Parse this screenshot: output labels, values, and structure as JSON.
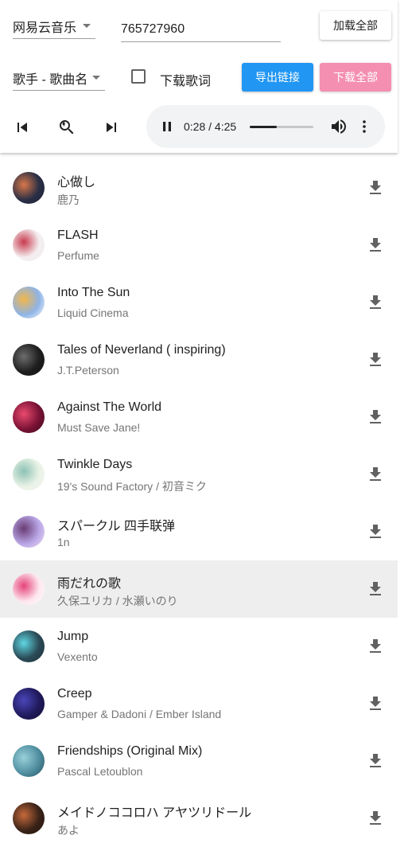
{
  "header": {
    "source_select": {
      "value": "网易云音乐"
    },
    "playlist_input": {
      "value": "765727960"
    },
    "load_all_label": "加载全部",
    "format_select": {
      "value": "歌手 - 歌曲名"
    },
    "lyrics_checkbox": {
      "label": "下载歌词",
      "checked": false
    },
    "export_links_label": "导出链接",
    "download_all_label": "下载全部"
  },
  "controls": {
    "icons": [
      "skip-previous-icon",
      "search-replay-icon",
      "skip-next-icon"
    ]
  },
  "player": {
    "time": "0:28 / 4:25",
    "progress": 0.42,
    "icons": [
      "pause-icon",
      "volume-icon",
      "more-vertical-icon"
    ]
  },
  "colors": {
    "blue": "#2196f3",
    "pink": "#f48fb1",
    "highlight": "#eeeeee"
  },
  "songs": [
    {
      "title": "心做し",
      "artist": "鹿乃",
      "highlight": false,
      "cover": [
        "#2a2f45",
        "#d9774a",
        "#1b2135"
      ]
    },
    {
      "title": "FLASH",
      "artist": "Perfume",
      "highlight": false,
      "cover": [
        "#f4eef0",
        "#c83a4d",
        "#eee"
      ]
    },
    {
      "title": "Into The Sun",
      "artist": "Liquid Cinema",
      "highlight": false,
      "cover": [
        "#8fb4e6",
        "#f2b64b",
        "#fff"
      ]
    },
    {
      "title": "Tales of Neverland ( inspiring)",
      "artist": "J.T.Peterson",
      "highlight": false,
      "cover": [
        "#1e1e1e",
        "#6d6d6d",
        "#111"
      ]
    },
    {
      "title": "Against The World",
      "artist": "Must Save Jane!",
      "highlight": false,
      "cover": [
        "#7a1236",
        "#e94a6e",
        "#3a0a1c"
      ]
    },
    {
      "title": "Twinkle Days",
      "artist": "19's Sound Factory / 初音ミク",
      "highlight": false,
      "cover": [
        "#e9f2e6",
        "#8dc2b4",
        "#f5f5f0"
      ]
    },
    {
      "title": "スパークル 四手联弹",
      "artist": "1n",
      "highlight": false,
      "cover": [
        "#b9a6e6",
        "#6a3c74",
        "#efdff3"
      ]
    },
    {
      "title": "雨だれの歌",
      "artist": "久保ユリカ / 水瀬いのり",
      "highlight": true,
      "cover": [
        "#fde6ee",
        "#e5437a",
        "#fff"
      ]
    },
    {
      "title": "Jump",
      "artist": "Vexento",
      "highlight": false,
      "cover": [
        "#2a4a55",
        "#5fd7e4",
        "#1c333c"
      ]
    },
    {
      "title": "Creep",
      "artist": "Gamper & Dadoni / Ember Island",
      "highlight": false,
      "cover": [
        "#201a5c",
        "#4a46b8",
        "#120d33"
      ]
    },
    {
      "title": "Friendships (Original Mix)",
      "artist": "Pascal Letoublon",
      "highlight": false,
      "cover": [
        "#4f8ea0",
        "#9ad0d9",
        "#24505c"
      ]
    },
    {
      "title": "メイドノココロハ アヤツリドール",
      "artist": "あよ",
      "highlight": false,
      "cover": [
        "#3a2318",
        "#c66a3c",
        "#1f120a"
      ]
    }
  ]
}
